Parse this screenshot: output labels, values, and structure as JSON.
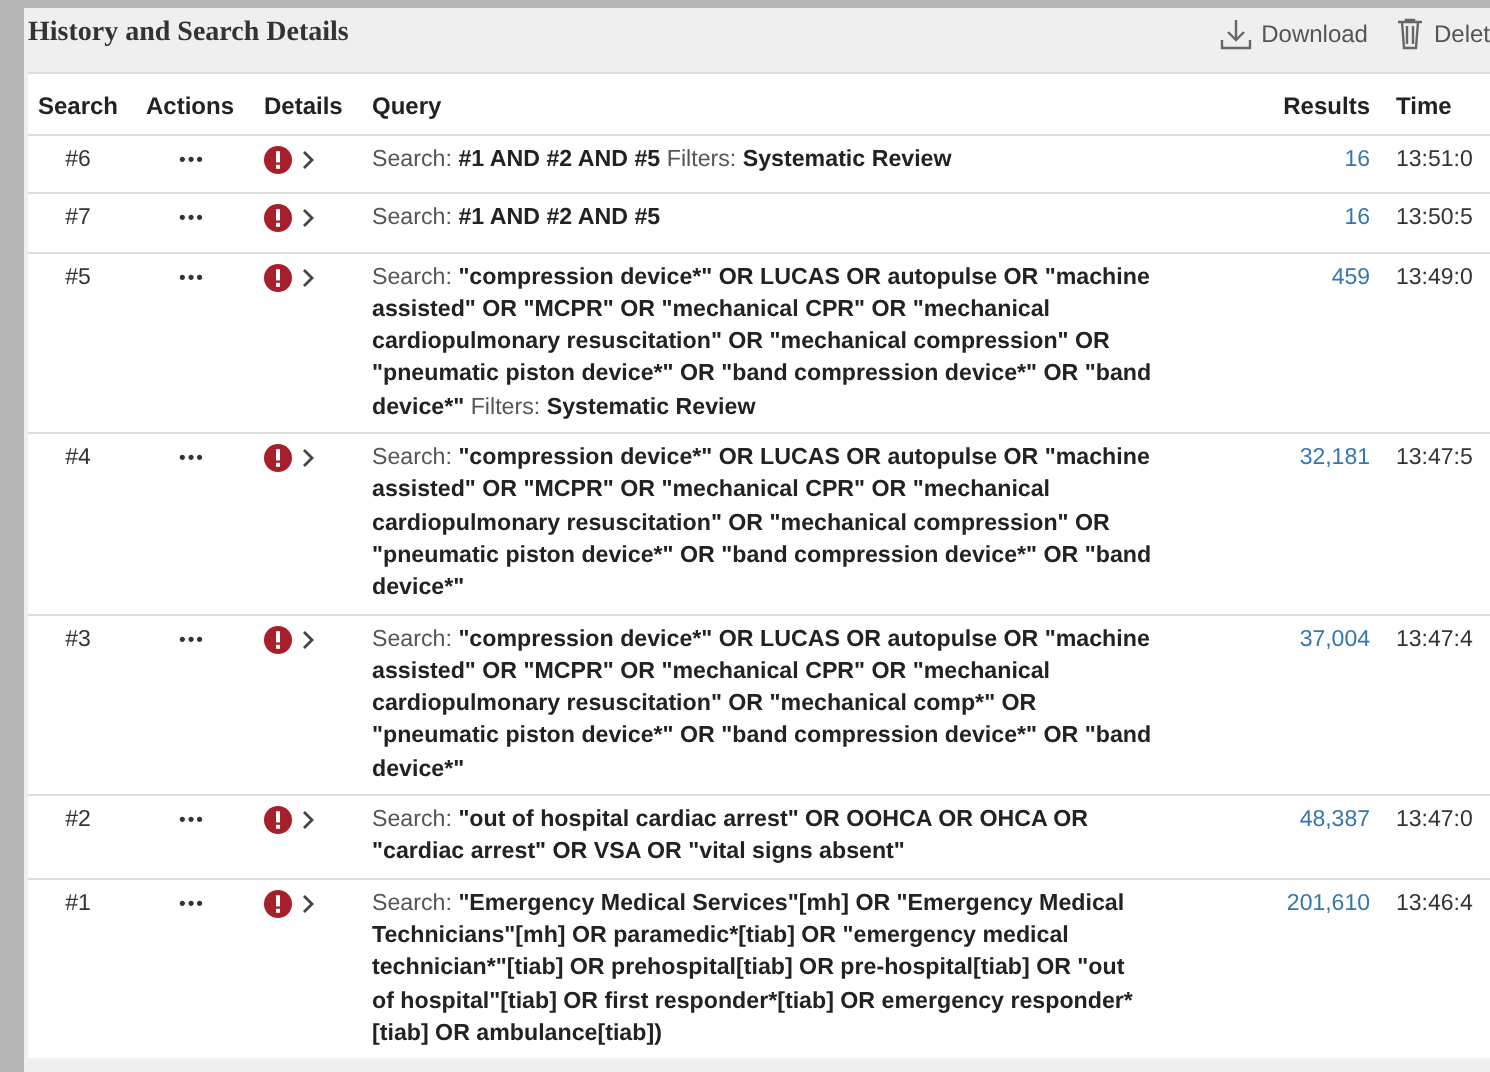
{
  "title": "History and Search Details",
  "toolbar": [
    {
      "kind": "download",
      "label": "Download"
    },
    {
      "kind": "delete",
      "label": "Delet"
    }
  ],
  "columns": [
    "Search",
    "Actions",
    "Details",
    "Query",
    "Results",
    "Time"
  ],
  "rows": [
    {
      "search": "#6",
      "actions": "•••",
      "query": "Search: **#1 AND #2 AND #5** Filters: **Systematic Review**",
      "results": "16",
      "time": "13:51:0"
    },
    {
      "search": "#7",
      "actions": "•••",
      "query": "Search: **#1 AND #2 AND #5**",
      "results": "16",
      "time": "13:50:5"
    },
    {
      "search": "#5",
      "actions": "•••",
      "query": "Search: **\"compression device*\" OR LUCAS OR autopulse OR \"machine assisted\" OR \"MCPR\" OR \"mechanical CPR\" OR \"mechanical cardiopulmonary resuscitation\" OR \"mechanical compression\" OR \"pneumatic piston device*\" OR \"band compression device*\" OR \"band device*\"** Filters: **Systematic Review**",
      "results": "459",
      "time": "13:49:0"
    },
    {
      "search": "#4",
      "actions": "•••",
      "query": "Search: **\"compression device*\" OR LUCAS OR autopulse OR \"machine assisted\" OR \"MCPR\" OR \"mechanical CPR\" OR \"mechanical cardiopulmonary resuscitation\" OR \"mechanical compression\" OR \"pneumatic piston device*\" OR \"band compression device*\" OR \"band device*\"**",
      "results": "32,181",
      "time": "13:47:5"
    },
    {
      "search": "#3",
      "actions": "•••",
      "query": "Search: **\"compression device*\" OR LUCAS OR autopulse OR \"machine assisted\" OR \"MCPR\" OR \"mechanical CPR\" OR \"mechanical cardiopulmonary resuscitation\" OR \"mechanical comp*\" OR \"pneumatic piston device*\" OR \"band compression device*\" OR \"band device*\"**",
      "results": "37,004",
      "time": "13:47:4"
    },
    {
      "search": "#2",
      "actions": "•••",
      "query": "Search: **\"out of hospital cardiac arrest\" OR OOHCA OR OHCA OR \"cardiac arrest\" OR VSA OR \"vital signs absent\"**",
      "results": "48,387",
      "time": "13:47:0"
    },
    {
      "search": "#1",
      "actions": "•••",
      "query": "Search: **\"Emergency Medical Services\"[mh] OR \"Emergency Medical Technicians\"[mh] OR paramedic*[tiab] OR \"emergency medical technician*\"[tiab] OR prehospital[tiab] OR pre-hospital[tiab] OR \"out of hospital\"[tiab] OR first responder*[tiab] OR emergency responder* [tiab] OR ambulance[tiab])**",
      "results": "201,610",
      "time": "13:46:4"
    }
  ]
}
